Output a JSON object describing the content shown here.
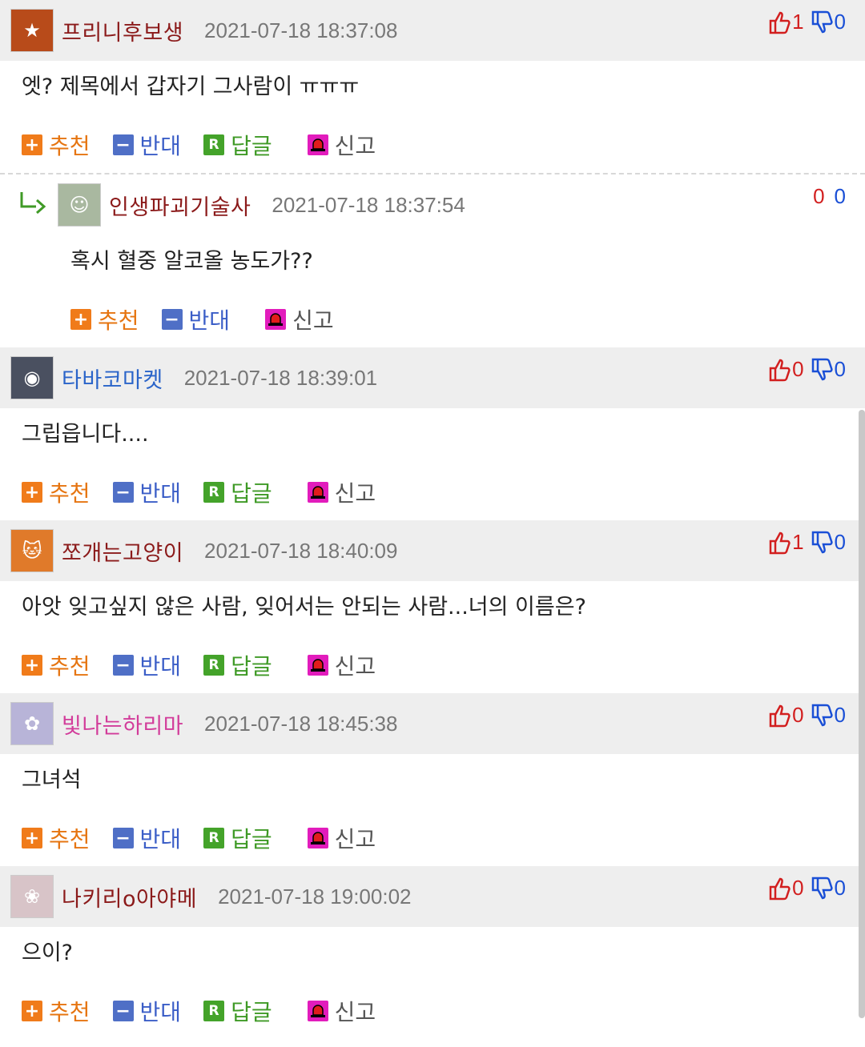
{
  "comments": [
    {
      "nick": "프리니후보생",
      "nick_color": "#8b1a1a",
      "date": "2021-07-18 18:37:08",
      "up": "1",
      "down": "0",
      "text": "엣? 제목에서 갑자기 그사람이 ㅠㅠㅠ",
      "avatar_bg": "#b84b1a"
    },
    {
      "nick": "인생파괴기술사",
      "nick_color": "#8b1a1a",
      "date": "2021-07-18 18:37:54",
      "up": "0",
      "down": "0",
      "text": "혹시 혈중 알코올 농도가??",
      "avatar_bg": "#a9b8a0"
    },
    {
      "nick": "타바코마켓",
      "nick_color": "#2a64c9",
      "date": "2021-07-18 18:39:01",
      "up": "0",
      "down": "0",
      "text": "그립읍니다....",
      "avatar_bg": "#4a5060"
    },
    {
      "nick": "쪼개는고양이",
      "nick_color": "#8b1a1a",
      "date": "2021-07-18 18:40:09",
      "up": "1",
      "down": "0",
      "text": "아앗 잊고싶지 않은 사람, 잊어서는 안되는 사람...너의 이름은?",
      "avatar_bg": "#e07a2a"
    },
    {
      "nick": "빛나는하리마",
      "nick_color": "#d23c9a",
      "date": "2021-07-18 18:45:38",
      "up": "0",
      "down": "0",
      "text": "그녀석",
      "avatar_bg": "#b8b4d8"
    },
    {
      "nick": "나키리o아야메",
      "nick_color": "#8b1a1a",
      "date": "2021-07-18 19:00:02",
      "up": "0",
      "down": "0",
      "text": "으이?",
      "avatar_bg": "#d8c4c8"
    }
  ],
  "actions": {
    "recommend": "추천",
    "oppose": "반대",
    "reply": "답글",
    "report": "신고"
  }
}
